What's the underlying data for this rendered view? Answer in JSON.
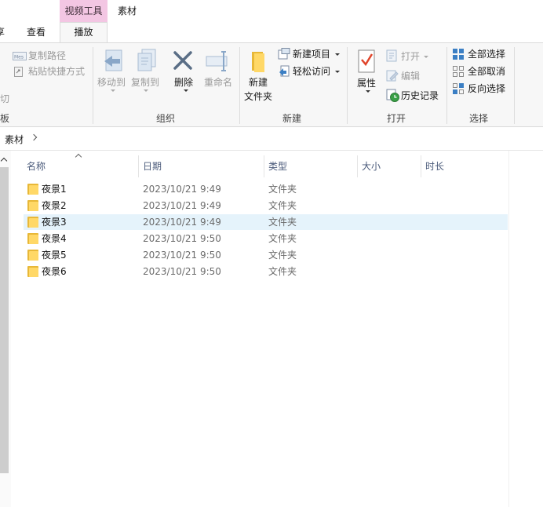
{
  "titlebar": {
    "context_group": "视频工具",
    "title": "素材",
    "tabs": {
      "share_partial": "享",
      "view": "查看",
      "play": "播放"
    }
  },
  "ribbon": {
    "clipboard": {
      "copy_path": "复制路径",
      "paste_shortcut": "粘贴快捷方式",
      "cut_partial": "切",
      "group_partial": "板"
    },
    "organize": {
      "move_to": "移动到",
      "copy_to": "复制到",
      "delete": "删除",
      "rename": "重命名",
      "group": "组织"
    },
    "new": {
      "new_folder_line1": "新建",
      "new_folder_line2": "文件夹",
      "new_item": "新建项目",
      "easy_access": "轻松访问",
      "group": "新建"
    },
    "open": {
      "properties": "属性",
      "open": "打开",
      "edit": "编辑",
      "history": "历史记录",
      "group": "打开"
    },
    "select": {
      "select_all": "全部选择",
      "select_none": "全部取消",
      "invert": "反向选择",
      "group": "选择"
    }
  },
  "address": {
    "crumb": "素材"
  },
  "columns": {
    "name": "名称",
    "date": "日期",
    "type": "类型",
    "size": "大小",
    "duration": "时长"
  },
  "rows": [
    {
      "name": "夜景1",
      "date": "2023/10/21 9:49",
      "type": "文件夹"
    },
    {
      "name": "夜景2",
      "date": "2023/10/21 9:49",
      "type": "文件夹"
    },
    {
      "name": "夜景3",
      "date": "2023/10/21 9:49",
      "type": "文件夹"
    },
    {
      "name": "夜景4",
      "date": "2023/10/21 9:50",
      "type": "文件夹"
    },
    {
      "name": "夜景5",
      "date": "2023/10/21 9:50",
      "type": "文件夹"
    },
    {
      "name": "夜景6",
      "date": "2023/10/21 9:50",
      "type": "文件夹"
    }
  ],
  "selected_row": 2,
  "colors": {
    "context_tab": "#f3c6e3",
    "selection": "#e5f3fb",
    "folder": "#ffd867",
    "accent": "#1e73c8"
  }
}
